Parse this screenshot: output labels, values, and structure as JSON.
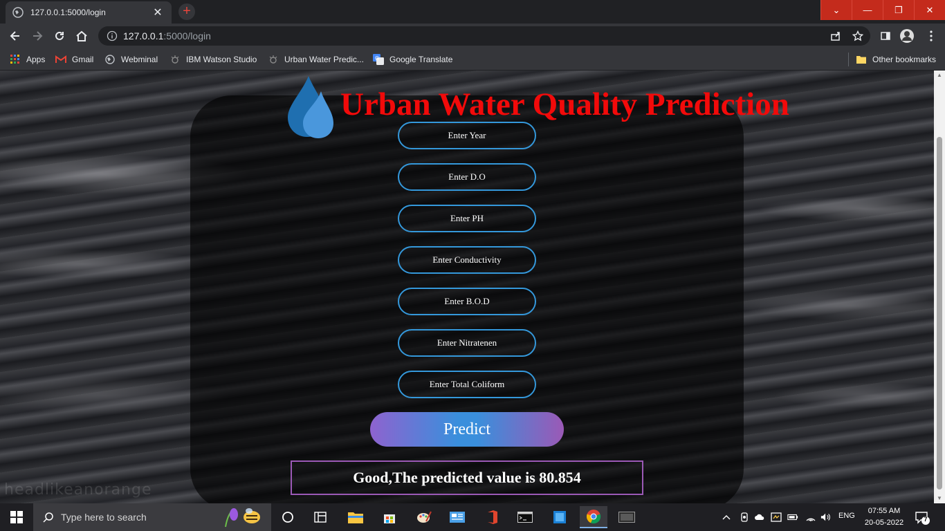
{
  "browser": {
    "tab_title": "127.0.0.1:5000/login",
    "new_tab": "+",
    "url_host": "127.0.0.1",
    "url_rest": ":5000/login",
    "bookmarks": [
      "Apps",
      "Gmail",
      "Webminal",
      "IBM Watson Studio",
      "Urban Water Predic...",
      "Google Translate"
    ],
    "other_bookmarks": "Other bookmarks"
  },
  "page": {
    "title": "Urban Water Quality Prediction",
    "watermark": "headlikeanorange",
    "fields": [
      {
        "placeholder": "Enter Year"
      },
      {
        "placeholder": "Enter D.O"
      },
      {
        "placeholder": "Enter PH"
      },
      {
        "placeholder": "Enter Conductivity"
      },
      {
        "placeholder": "Enter B.O.D"
      },
      {
        "placeholder": "Enter Nitratenen"
      },
      {
        "placeholder": "Enter Total Coliform"
      }
    ],
    "predict_label": "Predict",
    "result": "Good,The predicted value is 80.854"
  },
  "colors": {
    "title": "#f20a0a",
    "field_border": "#3498db",
    "result_border": "#9b59b6"
  },
  "taskbar": {
    "search_placeholder": "Type here to search",
    "lang": "ENG",
    "time": "07:55 AM",
    "date": "20-05-2022",
    "notifications": "7"
  }
}
